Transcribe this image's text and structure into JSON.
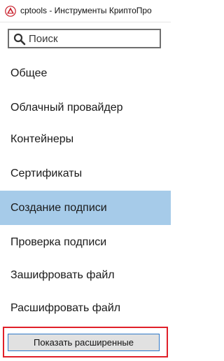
{
  "window": {
    "title": "cptools - Инструменты КриптоПро",
    "icon": "cryptopro-logo-icon"
  },
  "search": {
    "placeholder": "Поиск",
    "value": "",
    "icon": "search-icon"
  },
  "nav": {
    "items": [
      {
        "label": "Общее"
      },
      {
        "label": "Облачный провайдер"
      },
      {
        "label": "Контейнеры"
      },
      {
        "label": "Сертификаты"
      },
      {
        "label": "Создание подписи"
      },
      {
        "label": "Проверка подписи"
      },
      {
        "label": "Зашифровать файл"
      },
      {
        "label": "Расшифровать файл"
      }
    ],
    "selected": "Создание подписи"
  },
  "footer": {
    "advanced_button_label": "Показать расширенные"
  },
  "colors": {
    "selection": "#a6cbe9",
    "highlight_frame": "#e0202a",
    "button_border": "#2f78c8"
  }
}
